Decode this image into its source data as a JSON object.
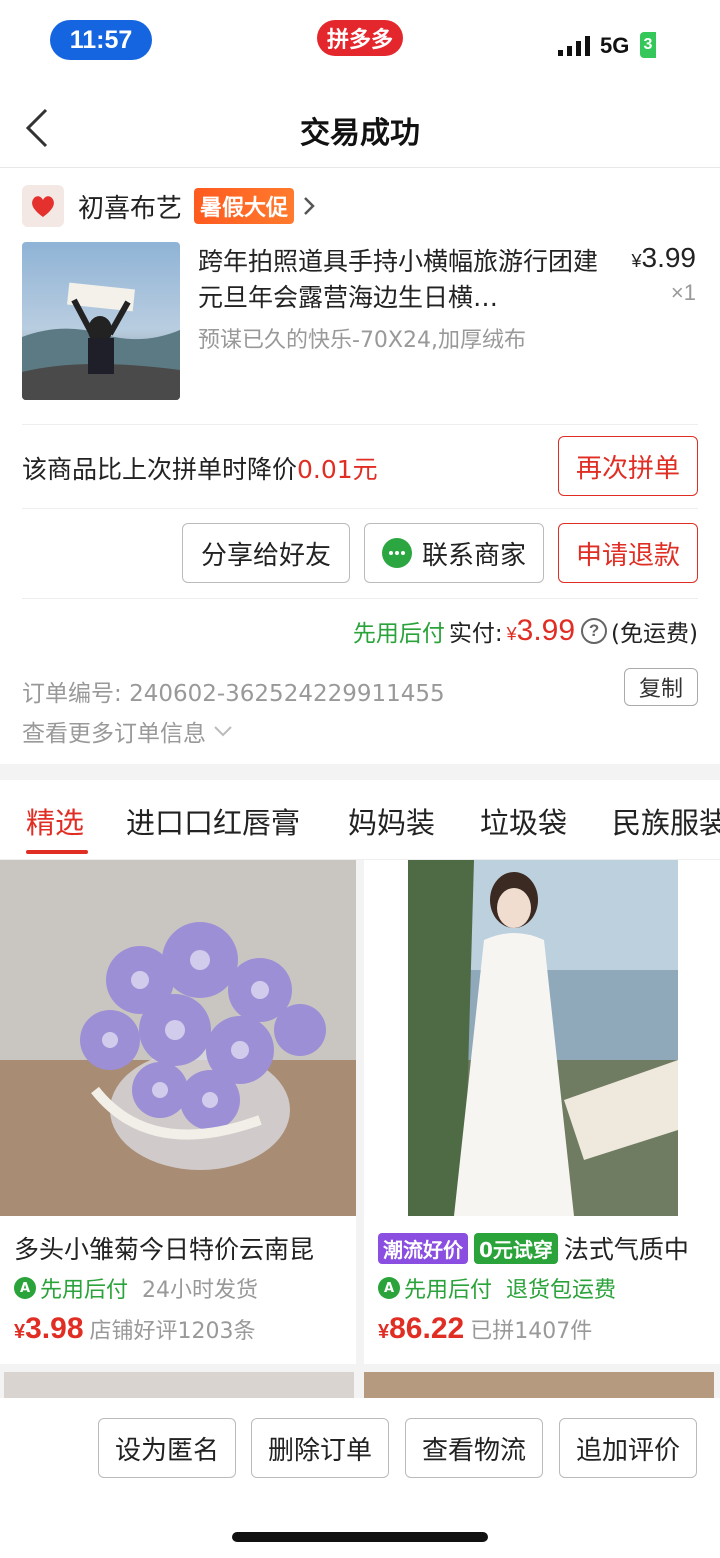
{
  "status_bar": {
    "time": "11:57",
    "app_badge": "拼多多",
    "network": "5G",
    "battery": "3"
  },
  "nav": {
    "title": "交易成功"
  },
  "shop": {
    "name": "初喜布艺",
    "promo_badge": "暑假大促"
  },
  "product": {
    "title": "跨年拍照道具手持小横幅旅游行团建元旦年会露营海边生日横…",
    "spec": "预谋已久的快乐-70X24,加厚绒布",
    "currency": "¥",
    "price": "3.99",
    "quantity": "×1"
  },
  "price_drop": {
    "text": "该商品比上次拼单时降价",
    "amount": "0.01元"
  },
  "actions": {
    "reorder": "再次拼单",
    "share": "分享给好友",
    "contact": "联系商家",
    "refund": "申请退款"
  },
  "payment": {
    "pay_later": "先用后付",
    "label": "实付:",
    "currency": "¥",
    "amount": "3.99",
    "help": "?",
    "shipping": "(免运费)"
  },
  "order": {
    "number_label": "订单编号:",
    "number": "240602-362524229911455",
    "copy": "复制",
    "more": "查看更多订单信息"
  },
  "tabs": [
    "精选",
    "进口口红唇膏",
    "妈妈装",
    "垃圾袋",
    "民族服装"
  ],
  "feed": [
    {
      "title": "多头小雏菊今日特价云南昆",
      "pay_later": "先用后付",
      "extra": "24小时发货",
      "currency": "¥",
      "price": "3.98",
      "meta": "店铺好评1203条"
    },
    {
      "tag1": "潮流好价",
      "tag2": "0元试穿",
      "title": "法式气质中",
      "pay_later": "先用后付",
      "extra": "退货包运费",
      "currency": "¥",
      "price": "86.22",
      "meta": "已拼1407件"
    }
  ],
  "bottom_bar": [
    "设为匿名",
    "删除订单",
    "查看物流",
    "追加评价"
  ],
  "colors": {
    "accent_red": "#e02e24",
    "green": "#2aa33a",
    "status_blue": "#1565e0"
  }
}
